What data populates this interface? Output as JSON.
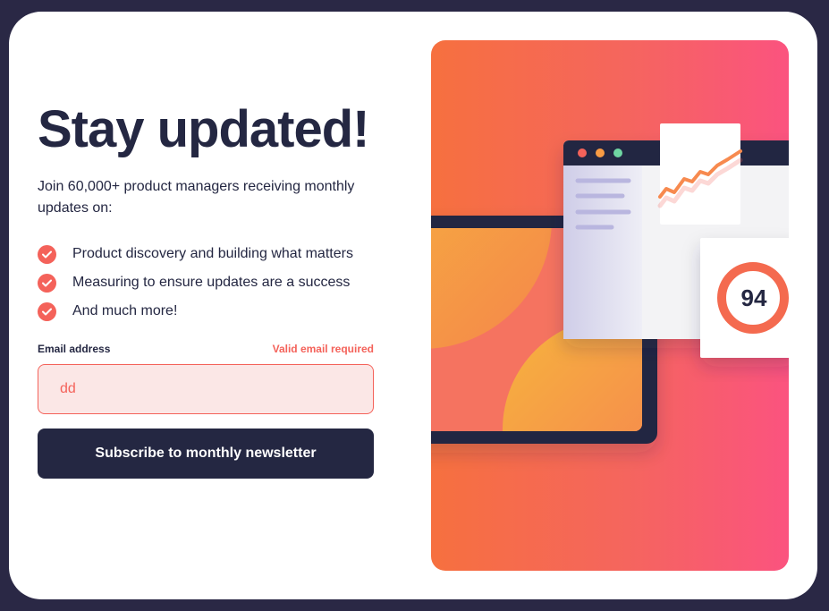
{
  "signup": {
    "title": "Stay updated!",
    "intro": "Join 60,000+ product managers receiving monthly updates on:",
    "features": [
      "Product discovery and building what matters",
      "Measuring to ensure updates are a success",
      "And much more!"
    ],
    "email_label": "Email address",
    "email_error": "Valid email required",
    "email_value": "dd",
    "button_label": "Subscribe to monthly newsletter"
  },
  "illustration": {
    "score": "94",
    "window_dots": [
      "#f4625a",
      "#f89b44",
      "#6fd6a3"
    ]
  },
  "colors": {
    "accent": "#f4625a",
    "dark": "#242742",
    "page_bg": "#2a2845"
  }
}
